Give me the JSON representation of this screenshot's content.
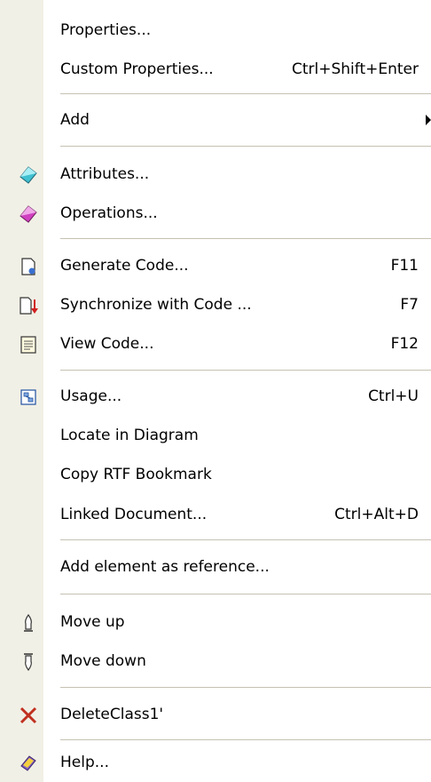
{
  "menu": {
    "items": [
      {
        "label": "Properties...",
        "shortcut": "",
        "icon": ""
      },
      {
        "label": "Custom Properties...",
        "shortcut": "Ctrl+Shift+Enter",
        "icon": ""
      },
      {
        "label": "Add",
        "shortcut": "",
        "icon": "",
        "submenu": true
      },
      {
        "label": "Attributes...",
        "shortcut": "",
        "icon": "attributes-icon"
      },
      {
        "label": "Operations...",
        "shortcut": "",
        "icon": "operations-icon"
      },
      {
        "label": "Generate Code...",
        "shortcut": "F11",
        "icon": "generate-code-icon"
      },
      {
        "label": "Synchronize with Code ...",
        "shortcut": "F7",
        "icon": "synchronize-code-icon"
      },
      {
        "label": "View Code...",
        "shortcut": "F12",
        "icon": "view-code-icon"
      },
      {
        "label": "Usage...",
        "shortcut": "Ctrl+U",
        "icon": "usage-icon"
      },
      {
        "label": "Locate in Diagram",
        "shortcut": "",
        "icon": ""
      },
      {
        "label": "Copy RTF Bookmark",
        "shortcut": "",
        "icon": ""
      },
      {
        "label": "Linked Document...",
        "shortcut": "Ctrl+Alt+D",
        "icon": ""
      },
      {
        "label": "Add element as reference...",
        "shortcut": "",
        "icon": ""
      },
      {
        "label": "Move up",
        "shortcut": "",
        "icon": "move-up-icon"
      },
      {
        "label": "Move down",
        "shortcut": "",
        "icon": "move-down-icon"
      },
      {
        "label": "DeleteClass1'",
        "shortcut": "",
        "icon": "delete-icon"
      },
      {
        "label": "Help...",
        "shortcut": "",
        "icon": "help-icon"
      }
    ]
  },
  "colors": {
    "gutter": "#f1f0e6",
    "separator": "#c5c2b2",
    "attributes_icon": "#40c0d0",
    "operations_icon": "#d040c0",
    "delete_icon": "#c03020",
    "help_icon": "#8060c0"
  }
}
